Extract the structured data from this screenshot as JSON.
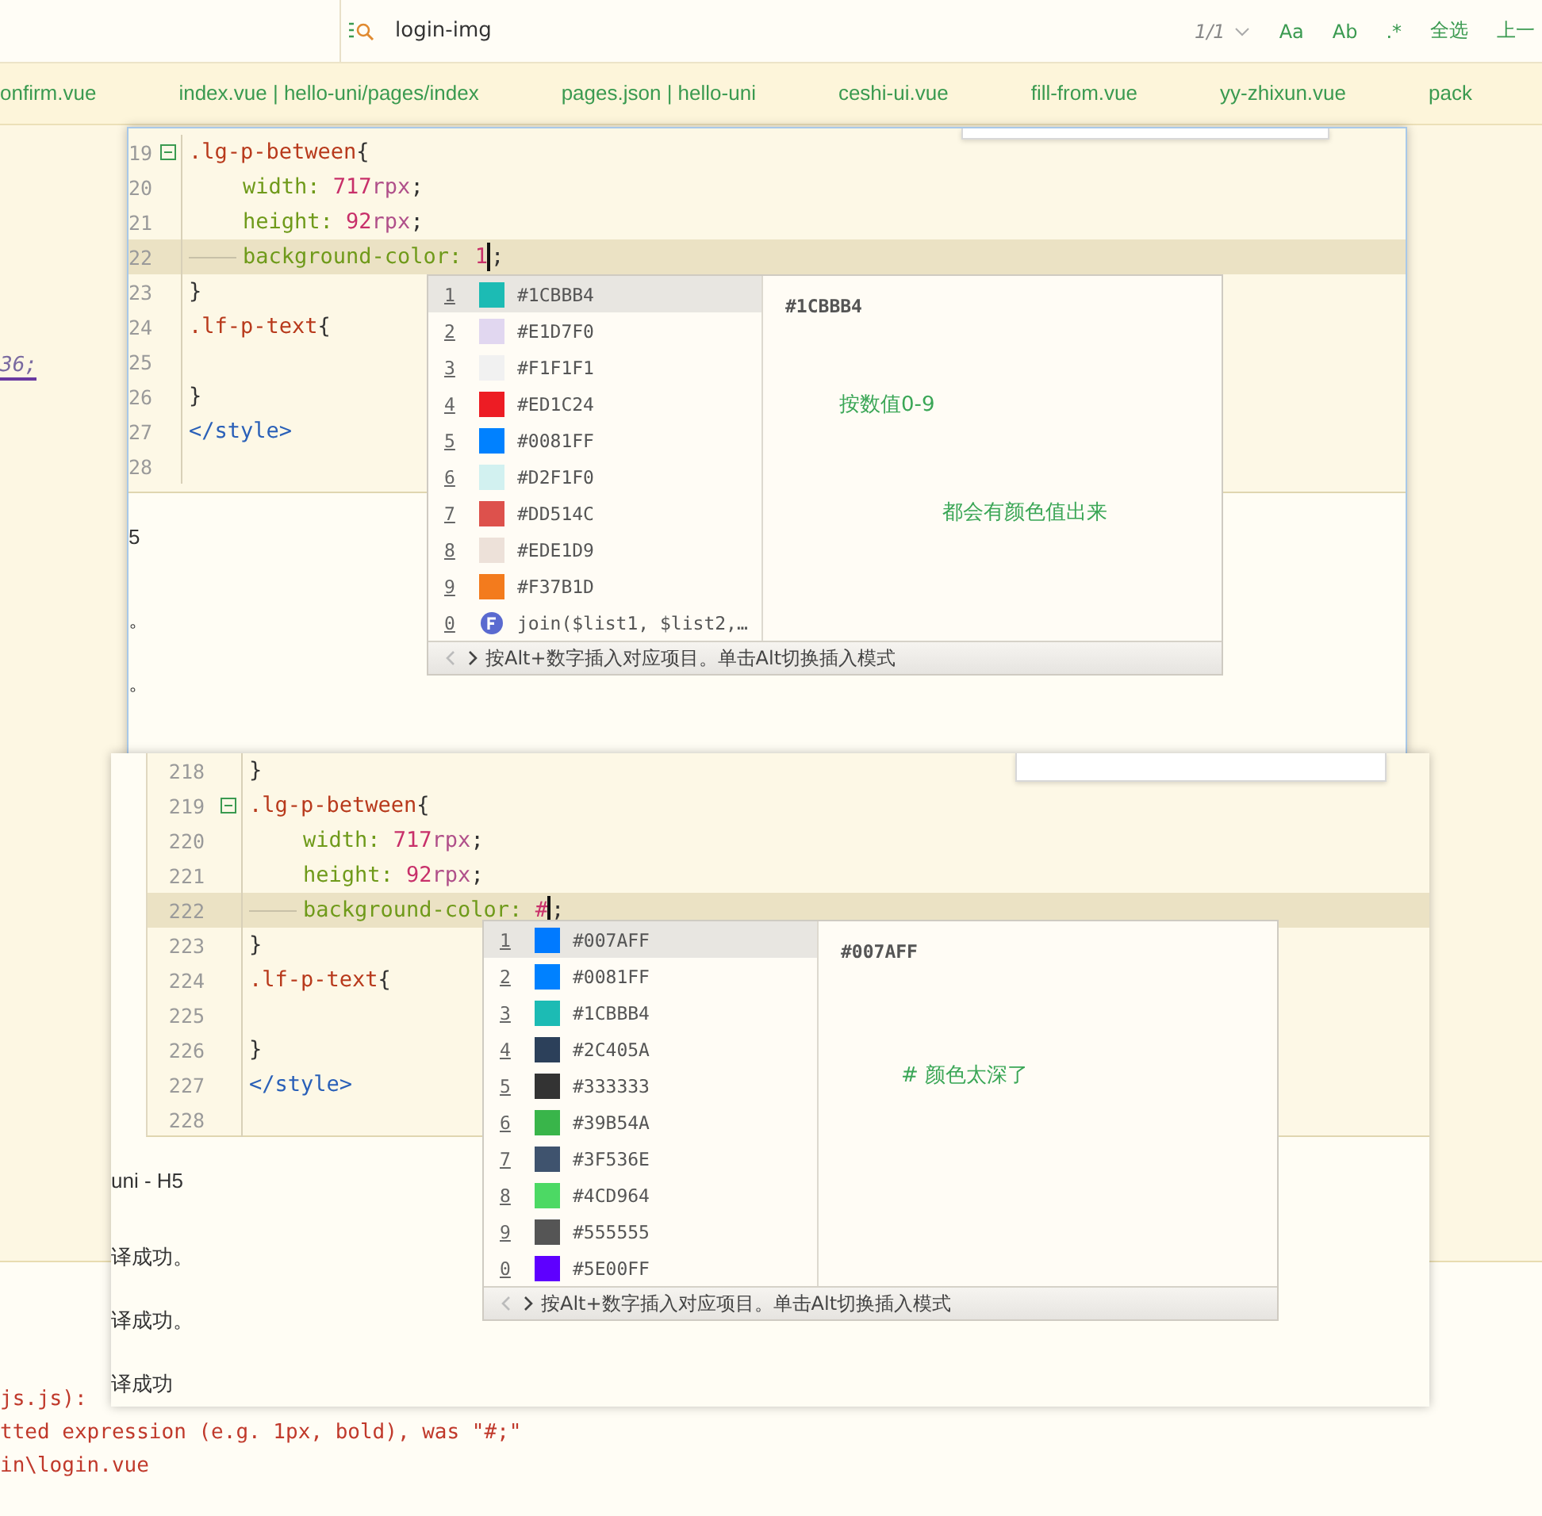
{
  "find_bar": {
    "query": "login-img",
    "match_count": "1/1",
    "options": [
      "Aa",
      "Ab",
      ".*"
    ],
    "buttons": [
      "全选",
      "上一"
    ]
  },
  "tabs": [
    {
      "label": "onfirm.vue",
      "selected": false
    },
    {
      "label": "index.vue | hello-uni/pages/index",
      "selected": false
    },
    {
      "label": "pages.json | hello-uni",
      "selected": false
    },
    {
      "label": "ceshi-ui.vue",
      "selected": false
    },
    {
      "label": "fill-from.vue",
      "selected": false
    },
    {
      "label": "yy-zhixun.vue",
      "selected": false
    },
    {
      "label": "pack",
      "selected": false
    }
  ],
  "background_code": "36;",
  "background_console": [
    {
      "text": "js.js):",
      "kind": "error"
    },
    {
      "text": "tted expression (e.g. 1px, bold), was \"#;\"",
      "kind": "error"
    },
    {
      "text": "in\\login.vue",
      "kind": "error"
    }
  ],
  "editors": [
    {
      "lines": [
        {
          "number": "19",
          "fold": true,
          "indented": false,
          "current": false,
          "tokens": [
            {
              "text": ".lg-p-between",
              "kind": "selector"
            },
            {
              "text": "{",
              "kind": "punct"
            }
          ]
        },
        {
          "number": "20",
          "fold": false,
          "indented": true,
          "current": false,
          "tokens": [
            {
              "text": "width: ",
              "kind": "property"
            },
            {
              "text": "717",
              "kind": "number"
            },
            {
              "text": "rpx",
              "kind": "unit"
            },
            {
              "text": ";",
              "kind": "punct"
            }
          ]
        },
        {
          "number": "21",
          "fold": false,
          "indented": true,
          "current": false,
          "tokens": [
            {
              "text": "height: ",
              "kind": "property"
            },
            {
              "text": "92",
              "kind": "number"
            },
            {
              "text": "rpx",
              "kind": "unit"
            },
            {
              "text": ";",
              "kind": "punct"
            }
          ]
        },
        {
          "number": "22",
          "fold": false,
          "indented": true,
          "current": true,
          "tokens": [
            {
              "text": "background-color: ",
              "kind": "property"
            },
            {
              "text": "1",
              "kind": "number",
              "caret": true
            },
            {
              "text": ";",
              "kind": "punct"
            }
          ]
        },
        {
          "number": "23",
          "fold": false,
          "indented": false,
          "current": false,
          "tokens": [
            {
              "text": "}",
              "kind": "punct"
            }
          ]
        },
        {
          "number": "24",
          "fold": false,
          "indented": false,
          "current": false,
          "tokens": [
            {
              "text": ".lf-p-text",
              "kind": "selector"
            },
            {
              "text": "{",
              "kind": "punct"
            }
          ]
        },
        {
          "number": "25",
          "fold": false,
          "current": false
        },
        {
          "number": "26",
          "fold": false,
          "indented": false,
          "current": false,
          "tokens": [
            {
              "text": "}",
              "kind": "punct"
            }
          ]
        },
        {
          "number": "27",
          "fold": false,
          "indented": false,
          "current": false,
          "tokens": [
            {
              "text": "</style>",
              "kind": "tag"
            }
          ]
        },
        {
          "number": "28",
          "fold": false,
          "current": false
        }
      ],
      "popup": {
        "items": [
          {
            "key": "1",
            "kind": "color",
            "color": "#1cbbb4",
            "label": "#1CBBB4",
            "selected": true
          },
          {
            "key": "2",
            "kind": "color",
            "color": "#e1d7f0",
            "label": "#E1D7F0",
            "selected": false
          },
          {
            "key": "3",
            "kind": "color",
            "color": "#f1f1f1",
            "label": "#F1F1F1",
            "selected": false
          },
          {
            "key": "4",
            "kind": "color",
            "color": "#ed1c24",
            "label": "#ED1C24",
            "selected": false
          },
          {
            "key": "5",
            "kind": "color",
            "color": "#0081ff",
            "label": "#0081FF",
            "selected": false
          },
          {
            "key": "6",
            "kind": "color",
            "color": "#d2f1f0",
            "label": "#D2F1F0",
            "selected": false
          },
          {
            "key": "7",
            "kind": "color",
            "color": "#dd514c",
            "label": "#DD514C",
            "selected": false
          },
          {
            "key": "8",
            "kind": "color",
            "color": "#ede1d9",
            "label": "#EDE1D9",
            "selected": false
          },
          {
            "key": "9",
            "kind": "color",
            "color": "#f37b1d",
            "label": "#F37B1D",
            "selected": false
          },
          {
            "key": "0",
            "kind": "function",
            "label": "join($list1, $list2,…",
            "selected": false
          }
        ],
        "preview_title": "#1CBBB4",
        "notes": [
          "按数值0-9",
          "都会有颜色值出来"
        ],
        "footer": "按Alt+数字插入对应项目。单击Alt切换插入模式"
      },
      "console": [
        "5",
        "。",
        "。"
      ]
    },
    {
      "lines": [
        {
          "number": "218",
          "fold": false,
          "indented": false,
          "current": false,
          "tokens": [
            {
              "text": "}",
              "kind": "punct"
            }
          ]
        },
        {
          "number": "219",
          "fold": true,
          "indented": false,
          "current": false,
          "tokens": [
            {
              "text": ".lg-p-between",
              "kind": "selector"
            },
            {
              "text": "{",
              "kind": "punct"
            }
          ]
        },
        {
          "number": "220",
          "fold": false,
          "indented": true,
          "current": false,
          "tokens": [
            {
              "text": "width: ",
              "kind": "property"
            },
            {
              "text": "717",
              "kind": "number"
            },
            {
              "text": "rpx",
              "kind": "unit"
            },
            {
              "text": ";",
              "kind": "punct"
            }
          ]
        },
        {
          "number": "221",
          "fold": false,
          "indented": true,
          "current": false,
          "tokens": [
            {
              "text": "height: ",
              "kind": "property"
            },
            {
              "text": "92",
              "kind": "number"
            },
            {
              "text": "rpx",
              "kind": "unit"
            },
            {
              "text": ";",
              "kind": "punct"
            }
          ]
        },
        {
          "number": "222",
          "fold": false,
          "indented": true,
          "current": true,
          "tokens": [
            {
              "text": "background-color: ",
              "kind": "property"
            },
            {
              "text": "#",
              "kind": "number",
              "caret": true
            },
            {
              "text": ";",
              "kind": "punct"
            }
          ]
        },
        {
          "number": "223",
          "fold": false,
          "indented": false,
          "current": false,
          "tokens": [
            {
              "text": "}",
              "kind": "punct"
            }
          ]
        },
        {
          "number": "224",
          "fold": false,
          "indented": false,
          "current": false,
          "tokens": [
            {
              "text": ".lf-p-text",
              "kind": "selector"
            },
            {
              "text": "{",
              "kind": "punct"
            }
          ]
        },
        {
          "number": "225",
          "fold": false,
          "current": false
        },
        {
          "number": "226",
          "fold": false,
          "indented": false,
          "current": false,
          "tokens": [
            {
              "text": "}",
              "kind": "punct"
            }
          ]
        },
        {
          "number": "227",
          "fold": false,
          "indented": false,
          "current": false,
          "tokens": [
            {
              "text": "</style>",
              "kind": "tag"
            }
          ]
        },
        {
          "number": "228",
          "fold": false,
          "current": false
        }
      ],
      "popup": {
        "items": [
          {
            "key": "1",
            "kind": "color",
            "color": "#007aff",
            "label": "#007AFF",
            "selected": true
          },
          {
            "key": "2",
            "kind": "color",
            "color": "#0081ff",
            "label": "#0081FF",
            "selected": false
          },
          {
            "key": "3",
            "kind": "color",
            "color": "#1cbbb4",
            "label": "#1CBBB4",
            "selected": false
          },
          {
            "key": "4",
            "kind": "color",
            "color": "#2c405a",
            "label": "#2C405A",
            "selected": false
          },
          {
            "key": "5",
            "kind": "color",
            "color": "#333333",
            "label": "#333333",
            "selected": false
          },
          {
            "key": "6",
            "kind": "color",
            "color": "#39b54a",
            "label": "#39B54A",
            "selected": false
          },
          {
            "key": "7",
            "kind": "color",
            "color": "#3f536e",
            "label": "#3F536E",
            "selected": false
          },
          {
            "key": "8",
            "kind": "color",
            "color": "#4cd964",
            "label": "#4CD964",
            "selected": false
          },
          {
            "key": "9",
            "kind": "color",
            "color": "#555555",
            "label": "#555555",
            "selected": false
          },
          {
            "key": "0",
            "kind": "color",
            "color": "#5e00ff",
            "label": "#5E00FF",
            "selected": false
          }
        ],
        "preview_title": "#007AFF",
        "notes": [
          "# 颜色太深了"
        ],
        "footer": "按Alt+数字插入对应项目。单击Alt切换插入模式"
      },
      "console": [
        "uni - H5",
        "译成功。",
        "译成功。",
        "译成功"
      ]
    }
  ]
}
